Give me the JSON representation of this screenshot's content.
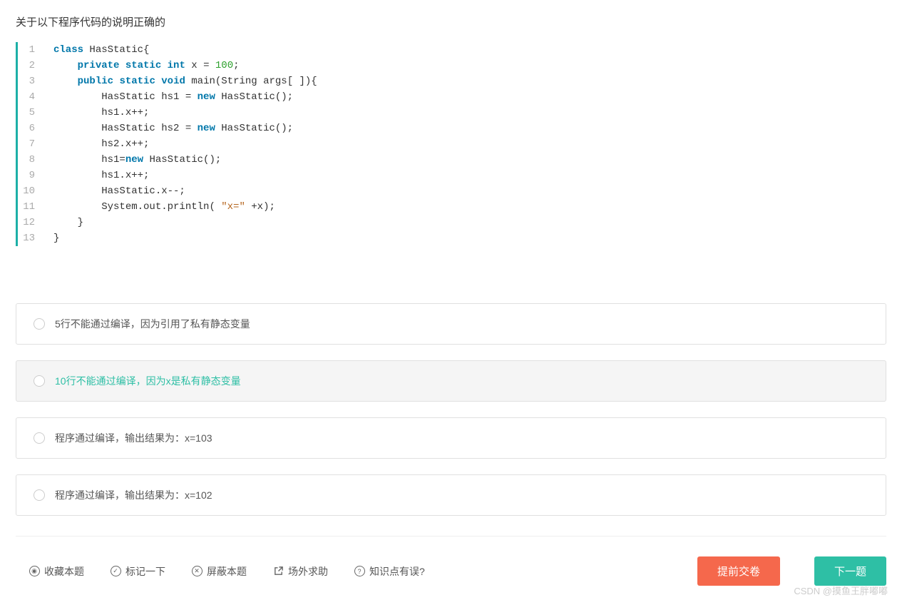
{
  "question": {
    "title": "关于以下程序代码的说明正确的"
  },
  "code": {
    "lines": [
      {
        "n": "1",
        "indent": 0,
        "tokens": [
          {
            "t": "class",
            "c": "kw"
          },
          {
            "t": " HasStatic{"
          }
        ]
      },
      {
        "n": "2",
        "indent": 1,
        "tokens": [
          {
            "t": "private",
            "c": "kw"
          },
          {
            "t": " "
          },
          {
            "t": "static",
            "c": "kw"
          },
          {
            "t": " "
          },
          {
            "t": "int",
            "c": "kw"
          },
          {
            "t": " x = "
          },
          {
            "t": "100",
            "c": "num"
          },
          {
            "t": ";"
          }
        ]
      },
      {
        "n": "3",
        "indent": 1,
        "tokens": [
          {
            "t": "public",
            "c": "kw"
          },
          {
            "t": " "
          },
          {
            "t": "static",
            "c": "kw"
          },
          {
            "t": " "
          },
          {
            "t": "void",
            "c": "kw"
          },
          {
            "t": " main(String args[ ]){"
          }
        ]
      },
      {
        "n": "4",
        "indent": 2,
        "tokens": [
          {
            "t": "HasStatic hs1 = "
          },
          {
            "t": "new",
            "c": "kw"
          },
          {
            "t": " HasStatic();"
          }
        ]
      },
      {
        "n": "5",
        "indent": 2,
        "tokens": [
          {
            "t": "hs1.x++;"
          }
        ]
      },
      {
        "n": "6",
        "indent": 2,
        "tokens": [
          {
            "t": "HasStatic hs2 = "
          },
          {
            "t": "new",
            "c": "kw"
          },
          {
            "t": " HasStatic();"
          }
        ]
      },
      {
        "n": "7",
        "indent": 2,
        "tokens": [
          {
            "t": "hs2.x++;"
          }
        ]
      },
      {
        "n": "8",
        "indent": 2,
        "tokens": [
          {
            "t": "hs1="
          },
          {
            "t": "new",
            "c": "kw"
          },
          {
            "t": " HasStatic();"
          }
        ]
      },
      {
        "n": "9",
        "indent": 2,
        "tokens": [
          {
            "t": "hs1.x++;"
          }
        ]
      },
      {
        "n": "10",
        "indent": 2,
        "tokens": [
          {
            "t": "HasStatic.x--;"
          }
        ]
      },
      {
        "n": "11",
        "indent": 2,
        "tokens": [
          {
            "t": "System.out.println( "
          },
          {
            "t": "\"x=\"",
            "c": "str"
          },
          {
            "t": " +x);"
          }
        ]
      },
      {
        "n": "12",
        "indent": 1,
        "tokens": [
          {
            "t": "}"
          }
        ]
      },
      {
        "n": "13",
        "indent": 0,
        "tokens": [
          {
            "t": "}"
          }
        ]
      }
    ]
  },
  "options": [
    {
      "text": "5行不能通过编译，因为引用了私有静态变量",
      "selected": false
    },
    {
      "text": "10行不能通过编译，因为x是私有静态变量",
      "selected": true
    },
    {
      "text": "程序通过编译，输出结果为：x=103",
      "selected": false
    },
    {
      "text": "程序通过编译，输出结果为：x=102",
      "selected": false
    }
  ],
  "footer": {
    "favorite": "收藏本题",
    "mark": "标记一下",
    "block": "屏蔽本题",
    "help": "场外求助",
    "knowledge": "知识点有误?",
    "submit": "提前交卷",
    "next": "下一题"
  },
  "watermark": "CSDN @摸鱼王胖嘟嘟"
}
